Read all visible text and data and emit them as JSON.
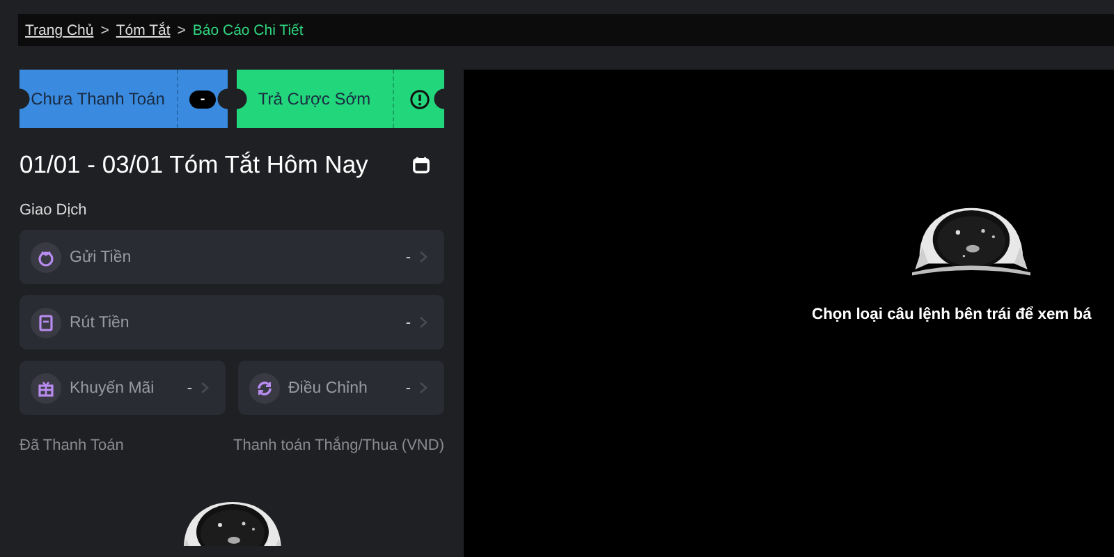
{
  "breadcrumb": [
    {
      "label": "Trang Chủ",
      "current": false
    },
    {
      "label": "Tóm Tắt",
      "current": false
    },
    {
      "label": "Báo Cáo Chi Tiết",
      "current": true
    }
  ],
  "separator": ">",
  "tickets": [
    {
      "kind": "badge",
      "label": "Chưa Thanh Toán",
      "value": "-",
      "color": "#3a8be0"
    },
    {
      "kind": "info",
      "label": "Trả Cược Sớm",
      "color": "#22d67c"
    }
  ],
  "summary_title": "01/01 - 03/01 Tóm Tắt Hôm Nay",
  "section_title": "Giao Dịch",
  "transactions": [
    [
      {
        "label": "Gửi Tiền",
        "value": "-"
      }
    ],
    [
      {
        "label": "Rút Tiền",
        "value": "-"
      }
    ],
    [
      {
        "label": "Khuyến Mãi",
        "value": "-"
      },
      {
        "label": "Điều Chỉnh",
        "value": "-"
      }
    ]
  ],
  "footer": {
    "left": "Đã Thanh Toán",
    "right": "Thanh toán Thắng/Thua (VND)"
  },
  "empty_message": "Chọn loại câu lệnh bên trái để xem bá"
}
